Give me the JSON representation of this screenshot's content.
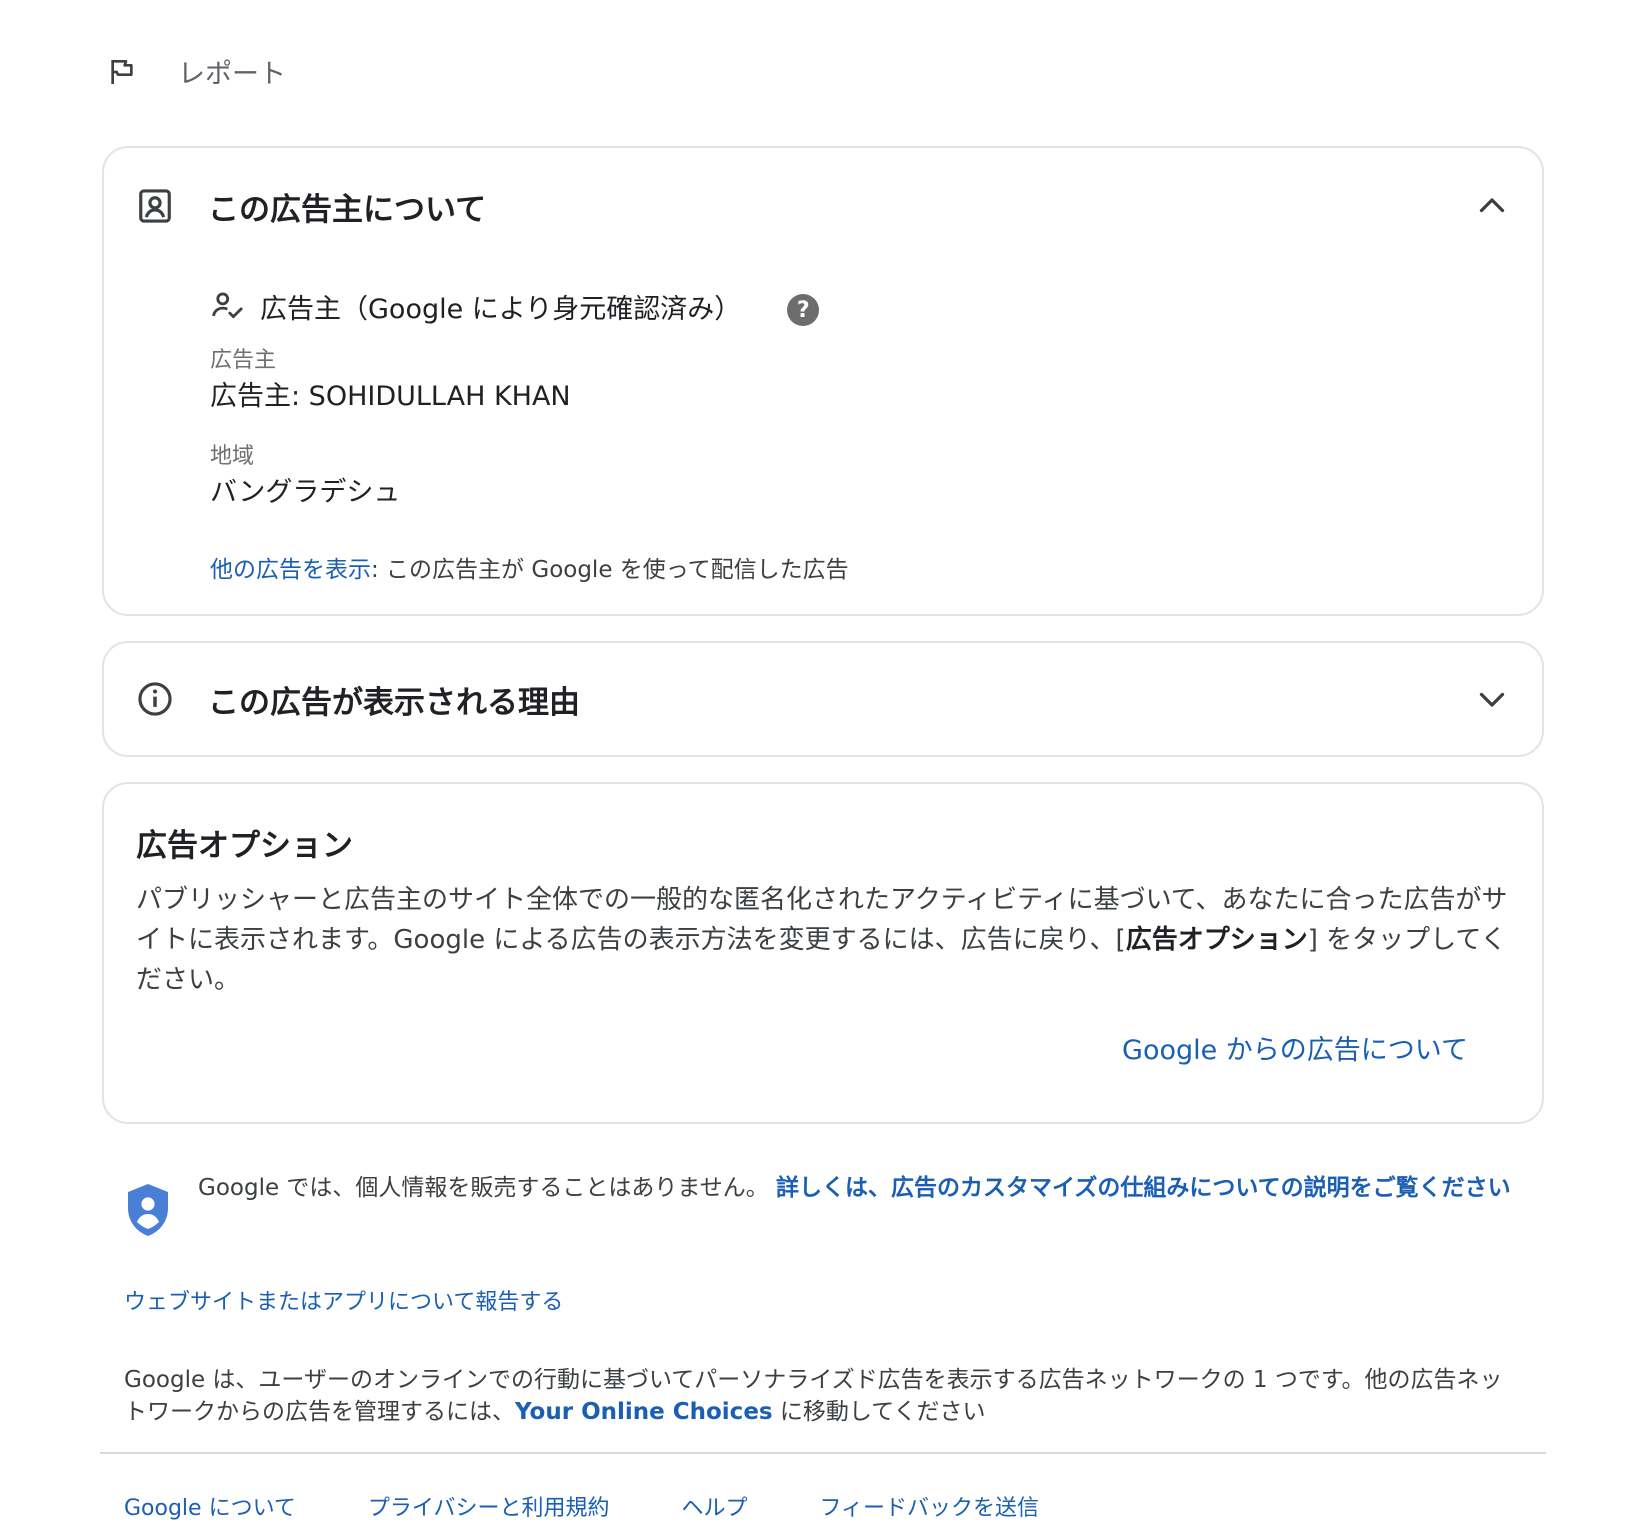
{
  "report": {
    "label": "レポート"
  },
  "advertiser_card": {
    "title": "この広告主について",
    "verified_label": "広告主（Google により身元確認済み）",
    "help_glyph": "?",
    "advertiser_label": "広告主",
    "advertiser_value": "広告主: SOHIDULLAH KHAN",
    "region_label": "地域",
    "region_value": "バングラデシュ",
    "more_ads_link": "他の広告を表示",
    "more_ads_text": ": この広告主が Google を使って配信した広告"
  },
  "why_card": {
    "title": "この広告が表示される理由"
  },
  "options_card": {
    "title": "広告オプション",
    "desc_part1": "パブリッシャーと広告主のサイト全体での一般的な匿名化されたアクティビティに基づいて、あなたに合った広告がサイトに表示されます。Google による広告の表示方法を変更するには、広告に戻り、[",
    "desc_bold": "広告オプション",
    "desc_part2": "] をタップしてください。",
    "link": "Google からの広告について"
  },
  "privacy": {
    "text": "Google では、個人情報を販売することはありません。",
    "link": "詳しくは、広告のカスタマイズの仕組みについての説明をご覧ください"
  },
  "report_site_link": "ウェブサイトまたはアプリについて報告する",
  "personalized": {
    "text1": "Google は、ユーザーのオンラインでの行動に基づいてパーソナライズド広告を表示する広告ネットワークの 1 つです。他の広告ネットワークからの広告を管理するには、",
    "link": "Your Online Choices",
    "text2": " に移動してください"
  },
  "footer": {
    "about": "Google について",
    "privacy": "プライバシーと利用規約",
    "help": "ヘルプ",
    "feedback": "フィードバックを送信"
  },
  "colors": {
    "link": "#1a5fb4",
    "shield": "#4a7fd6",
    "border": "#e3e3e3"
  }
}
